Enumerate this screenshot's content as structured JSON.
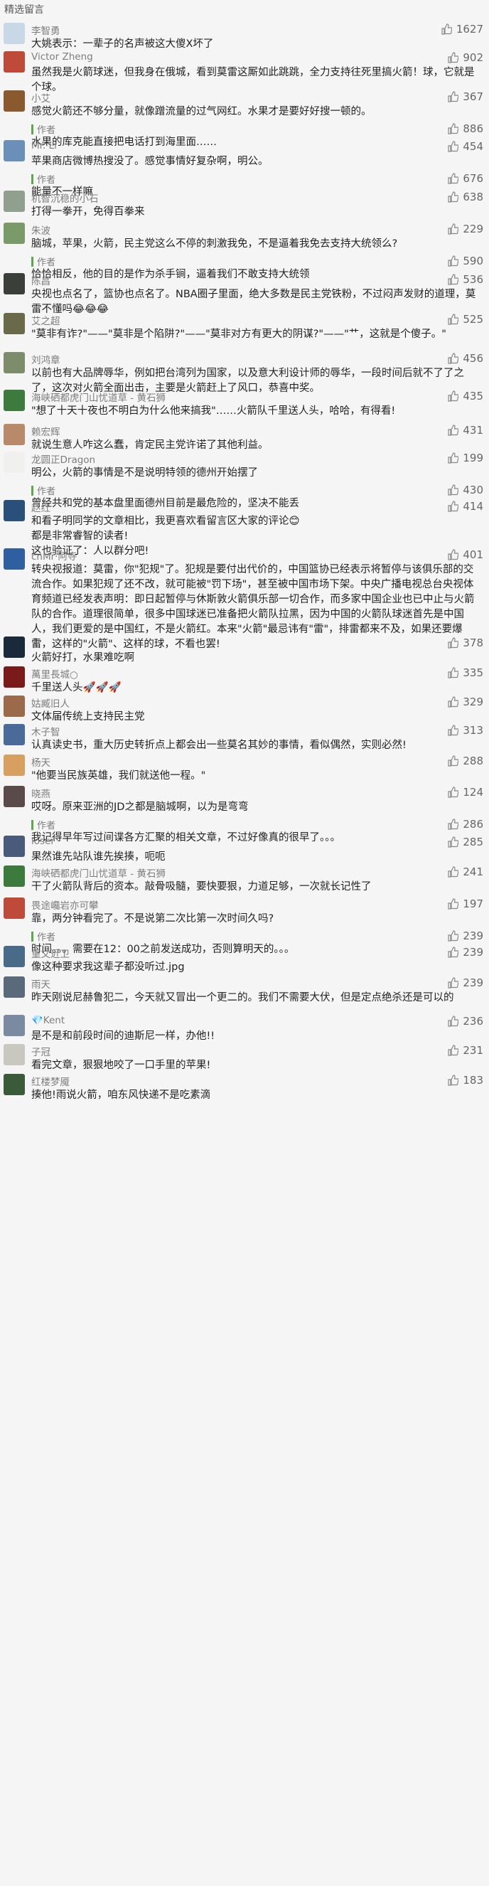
{
  "section_title": "精选留言",
  "comments": [
    {
      "name": "李智勇",
      "likes": "1627",
      "text": "大姚表示：一辈子的名声被这大傻X坏了"
    },
    {
      "name": "Victor Zheng",
      "likes": "902",
      "text": "虽然我是火箭球迷，但我身在俄城，看到莫雷这厮如此跳跳，全力支持往死里搞火箭！球，它就是个球。"
    },
    {
      "name": "小艾",
      "likes": "367",
      "text": "感觉火箭还不够分量，就像蹭流量的过气网红。水果才是要好好搜一顿的。",
      "author_label": "作者",
      "reply": "水果的库克能直接把电话打到海里面……",
      "reply_likes": "886"
    },
    {
      "name": "Mr. Li",
      "likes": "454",
      "text": "苹果商店微博热搜没了。感觉事情好复杂啊，明公。",
      "author_label": "作者",
      "reply": "能量不一样嘛",
      "reply_likes": "676"
    },
    {
      "name": "机智沉稳的小石",
      "likes": "638",
      "text": "打得一拳开，免得百拳来"
    },
    {
      "name": "朱波",
      "likes": "229",
      "text": "脑城，苹果，火箭，民主党这么不停的刺激我免，不是逼着我免去支持大统领么?",
      "author_label": "作者",
      "reply": "恰恰相反，他的目的是作为杀手锏，逼着我们不敢支持大统领",
      "reply_likes": "590"
    },
    {
      "name": "陈昌",
      "likes": "536",
      "text": "央视也点名了，篮协也点名了。NBA圈子里面，绝大多数是民主党铁粉，不过闷声发财的道理，莫雷不懂吗😂😂😂"
    },
    {
      "name": "艾之超",
      "likes": "525",
      "text": "\"莫非有诈?\"——\"莫非是个陷阱?\"——\"莫非对方有更大的阴谋?\"——\"艹，这就是个傻子。\""
    },
    {
      "name": "刘鸿章",
      "likes": "456",
      "text": "以前也有大品牌辱华，例如把台湾列为国家，以及意大利设计师的辱华，一段时间后就不了了之了，这次对火箭全面出击，主要是火箭赶上了风口，恭喜中奖。"
    },
    {
      "name": "海峡硒都虎门山忧道草 - 黄石狮",
      "likes": "435",
      "text": "\"想了十天十夜也不明白为什么他来搞我\"……火箭队千里送人头，哈哈，有得看!"
    },
    {
      "name": "赖宏辉",
      "likes": "431",
      "text": "就说生意人咋这么蠢，肯定民主党许诺了其他利益。"
    },
    {
      "name": "龙圆正Dragon",
      "likes": "199",
      "text": "明公，火箭的事情是不是说明特领的德州开始摆了",
      "author_label": "作者",
      "reply": "曾经共和党的基本盘里面德州目前是最危险的，坚决不能丢",
      "reply_likes": "430"
    },
    {
      "name": "赵红",
      "likes": "414",
      "text": "和看子明同学的文章相比，我更喜欢看留言区大家的评论😊\n都是非常睿智的读者!\n这也验证了：人以群分吧!"
    },
    {
      "name": "cnMr·阿寺",
      "likes": "401",
      "text": "转央视报道：莫雷，你\"犯规\"了。犯规是要付出代价的，中国篮协已经表示将暂停与该俱乐部的交流合作。如果犯规了还不改，就可能被\"罚下场\"，甚至被中国市场下架。中央广播电视总台央视体育频道已经发表声明：即日起暂停与休斯敦火箭俱乐部一切合作，而多家中国企业也已中止与火箭队的合作。道理很简单，很多中国球迷已准备把火箭队拉黑，因为中国的火箭队球迷首先是中国人，我们更爱的是中国红，不是火箭红。本来\"火箭\"最忌讳有\"雷\"，排雷都来不及，如果还要爆雷，这样的\"火箭\"、这样的球，不看也罢!"
    },
    {
      "name": "①",
      "likes": "378",
      "text": "火箭好打，水果难吃啊"
    },
    {
      "name": "萬里長城○",
      "likes": "335",
      "text": "千里送人头🚀🚀🚀"
    },
    {
      "name": "姑臧旧人",
      "likes": "329",
      "text": "文体届传统上支持民主党"
    },
    {
      "name": "木子智",
      "likes": "313",
      "text": "认真读史书，重大历史转折点上都会出一些莫名其妙的事情，看似偶然，实则必然!"
    },
    {
      "name": "杨天",
      "likes": "288",
      "text": "\"他要当民族英雄，我们就送他一程。\""
    },
    {
      "name": "晓燕",
      "likes": "124",
      "text": "哎呀。原来亚洲的JD之都是脑城啊，以为是弯弯",
      "author_label": "作者",
      "reply": "我记得早年写过间谍各方汇聚的相关文章，不过好像真的很早了。。。",
      "reply_likes": "286"
    },
    {
      "name": "loser",
      "likes": "285",
      "text": "果然谁先站队谁先挨揍，呃呃"
    },
    {
      "name": "海峡硒都虎门山忧道草 - 黄石狮",
      "likes": "241",
      "text": "干了火箭队背后的资本。敲骨吸髓，要快要狠，力道足够，一次就长记性了"
    },
    {
      "name": "畏途巉岩亦可攀",
      "likes": "197",
      "text": "靠，两分钟看完了。不是说第二次比第一次时间久吗?",
      "author_label": "作者",
      "reply": "时间。。。需要在12：00之前发送成功，否则算明天的。。。",
      "reply_likes": "239"
    },
    {
      "name": "重文近卫",
      "likes": "239",
      "text": "像这种要求我这辈子都没听过.jpg"
    },
    {
      "name": "雨天",
      "likes": "239",
      "text": "昨天刚说尼赫鲁犯二，今天就又冒出一个更二的。我们不需要大伏，但是定点绝杀还是可以的"
    },
    {
      "name": "💎Kent",
      "likes": "236",
      "text": "是不是和前段时间的迪斯尼一样，办他!!"
    },
    {
      "name": "子冠",
      "likes": "231",
      "text": "看完文章，狠狠地咬了一口手里的苹果!"
    },
    {
      "name": "红楼梦魇",
      "likes": "183",
      "text": "揍他!雨说火箭，咱东风快递不是吃素滴"
    }
  ]
}
